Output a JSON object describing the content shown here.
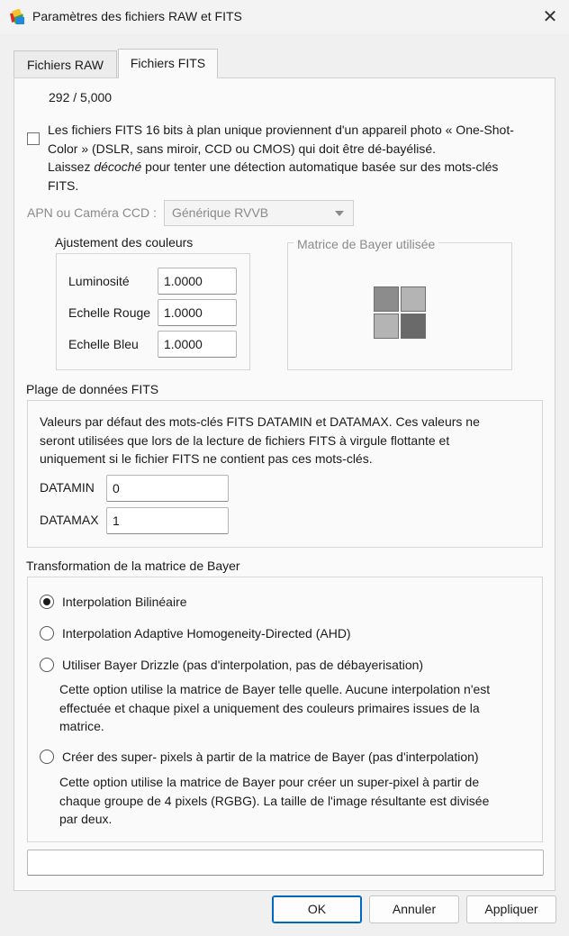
{
  "window": {
    "title": "Paramètres des fichiers RAW et FITS",
    "close_glyph": "✕"
  },
  "tabs": [
    {
      "label": "Fichiers RAW"
    },
    {
      "label": "Fichiers FITS"
    }
  ],
  "progress": {
    "text": "292 / 5,000"
  },
  "osc_checkbox": {
    "checked": false,
    "line1": "Les fichiers FITS 16 bits à plan unique proviennent d'un appareil photo « One-Shot-",
    "line2": "Color » (DSLR, sans miroir, CCD ou CMOS) qui doit être dé-bayélisé.",
    "line3_pre": "Laissez ",
    "line3_em": "décoché",
    "line3_post": " pour tenter une détection automatique basée sur des mots-clés",
    "line4": "FITS."
  },
  "camera": {
    "label": "APN ou Caméra CCD :",
    "value": "Générique RVVB"
  },
  "color_adjust": {
    "title": "Ajustement des couleurs",
    "rows": [
      {
        "label": "Luminosité",
        "value": "1.0000"
      },
      {
        "label": "Echelle Rouge",
        "value": "1.0000"
      },
      {
        "label": "Echelle Bleu",
        "value": "1.0000"
      }
    ]
  },
  "bayer_matrix": {
    "title": "Matrice de Bayer utilisée",
    "cells": [
      "#8c8c8c",
      "#b4b4b4",
      "#b4b4b4",
      "#6a6a6a"
    ]
  },
  "fits_range": {
    "title": "Plage de données FITS",
    "desc1": "Valeurs par défaut des mots-clés FITS DATAMIN et DATAMAX. Ces valeurs ne",
    "desc2": "seront utilisées que lors de la lecture de fichiers FITS à virgule flottante et",
    "desc3": "uniquement si le fichier FITS ne contient pas ces mots-clés.",
    "datamin_label": "DATAMIN",
    "datamin_value": "0",
    "datamax_label": "DATAMAX",
    "datamax_value": "1"
  },
  "bayer_transform": {
    "title": "Transformation de la matrice de Bayer",
    "options": [
      {
        "label": "Interpolation Bilinéaire",
        "checked": true
      },
      {
        "label": "Interpolation Adaptive Homogeneity-Directed (AHD)",
        "checked": false
      },
      {
        "label": "Utiliser Bayer Drizzle (pas d'interpolation, pas de débayerisation)",
        "checked": false,
        "desc": [
          "Cette option utilise la matrice de Bayer telle quelle. Aucune interpolation n'est",
          "effectuée et chaque pixel a uniquement des couleurs primaires issues de la",
          "matrice."
        ]
      },
      {
        "label": "Créer des super- pixels à partir de la matrice de Bayer (pas d'interpolation)",
        "checked": false,
        "desc": [
          "Cette option utilise la matrice de Bayer pour créer un super-pixel à partir de",
          "chaque groupe de 4 pixels (RGBG). La taille de l'image résultante est divisée",
          "par deux."
        ]
      }
    ]
  },
  "status_field": {
    "value": ""
  },
  "buttons": {
    "ok": "OK",
    "cancel": "Annuler",
    "apply": "Appliquer"
  }
}
